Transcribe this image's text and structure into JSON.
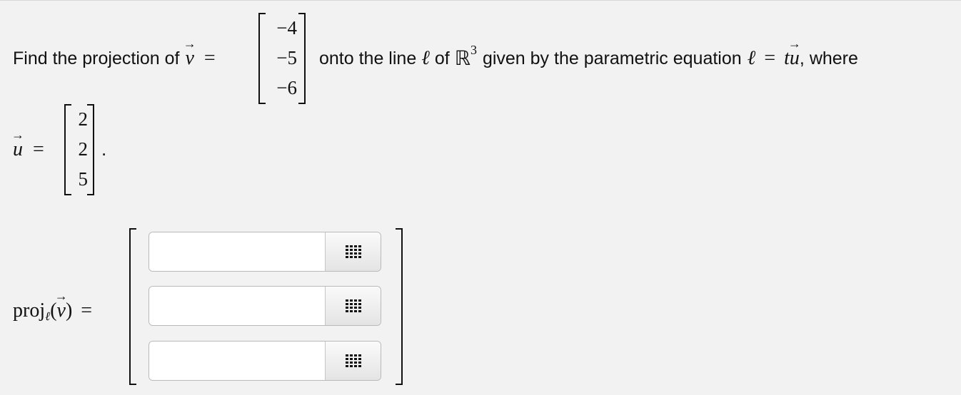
{
  "question": {
    "prefix": "Find the projection of",
    "v_symbol": "v",
    "equals": "=",
    "v_entries": [
      "−4",
      "−5",
      "−6"
    ],
    "mid_text_1": "onto the line",
    "ell": "ℓ",
    "mid_text_2": "of",
    "space": "ℝ",
    "space_exp": "3",
    "mid_text_3": "given by the parametric equation",
    "t": "t",
    "u_symbol": "u",
    "suffix": ", where"
  },
  "u_vector": {
    "symbol": "u",
    "equals": "=",
    "entries": [
      "2",
      "2",
      "5"
    ],
    "period": "."
  },
  "answer": {
    "label_proj": "proj",
    "label_sub": "ℓ",
    "label_open": "(",
    "label_v": "v",
    "label_close": ")",
    "equals": "=",
    "fields": [
      {
        "value": "",
        "placeholder": "",
        "button_icon": "matrix-grid-icon"
      },
      {
        "value": "",
        "placeholder": "",
        "button_icon": "matrix-grid-icon"
      },
      {
        "value": "",
        "placeholder": "",
        "button_icon": "matrix-grid-icon"
      }
    ]
  }
}
